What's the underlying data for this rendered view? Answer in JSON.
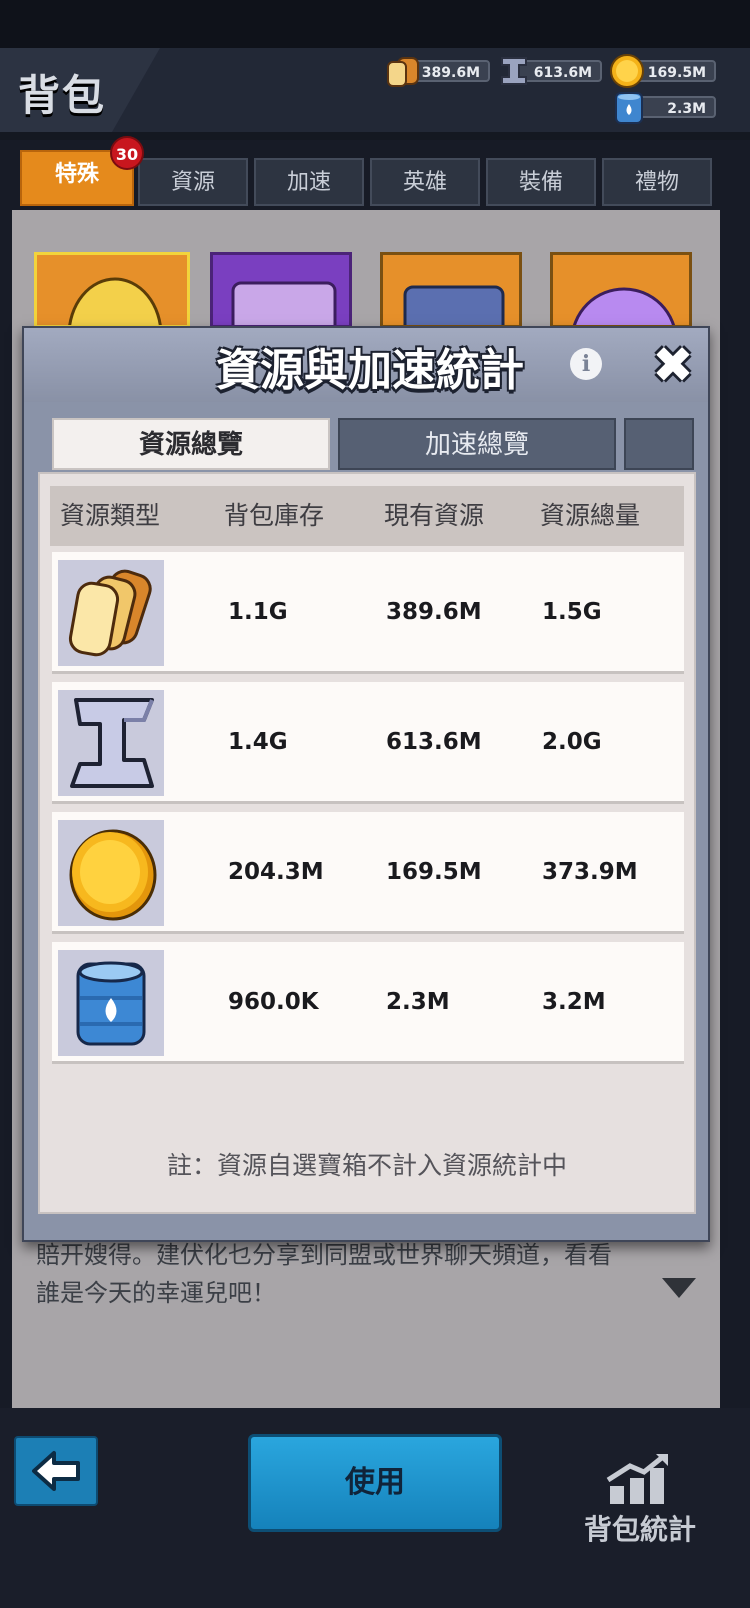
{
  "header": {
    "title": "背包",
    "resources": [
      {
        "icon": "bread-icon",
        "value": "389.6M"
      },
      {
        "icon": "iron-icon",
        "value": "613.6M"
      },
      {
        "icon": "gold-coin-icon",
        "value": "169.5M"
      },
      {
        "icon": "oil-barrel-icon",
        "value": "2.3M"
      }
    ]
  },
  "tabs": [
    {
      "label": "特殊",
      "active": true
    },
    {
      "label": "資源"
    },
    {
      "label": "加速"
    },
    {
      "label": "英雄"
    },
    {
      "label": "裝備"
    },
    {
      "label": "禮物"
    }
  ],
  "tab_badge": "30",
  "behind_text": {
    "line1": "賠开嫂得。建伏化乜分享到同盟或世界聊天頻道，看看",
    "line2": "誰是今天的幸運兒吧！"
  },
  "modal": {
    "title": "資源與加速統計",
    "info_label": "i",
    "close_label": "✖",
    "sub_tabs": [
      "資源總覽",
      "加速總覽"
    ],
    "table": {
      "headers": [
        "資源類型",
        "背包庫存",
        "現有資源",
        "資源總量"
      ],
      "rows": [
        {
          "icon": "bread-icon",
          "bag": "1.1G",
          "current": "389.6M",
          "total": "1.5G"
        },
        {
          "icon": "iron-icon",
          "bag": "1.4G",
          "current": "613.6M",
          "total": "2.0G"
        },
        {
          "icon": "gold-coin-icon",
          "bag": "204.3M",
          "current": "169.5M",
          "total": "373.9M"
        },
        {
          "icon": "oil-barrel-icon",
          "bag": "960.0K",
          "current": "2.3M",
          "total": "3.2M"
        }
      ]
    },
    "note": "註：資源自選寶箱不計入資源統計中"
  },
  "footer": {
    "use_label": "使用",
    "stats_label": "背包統計"
  }
}
